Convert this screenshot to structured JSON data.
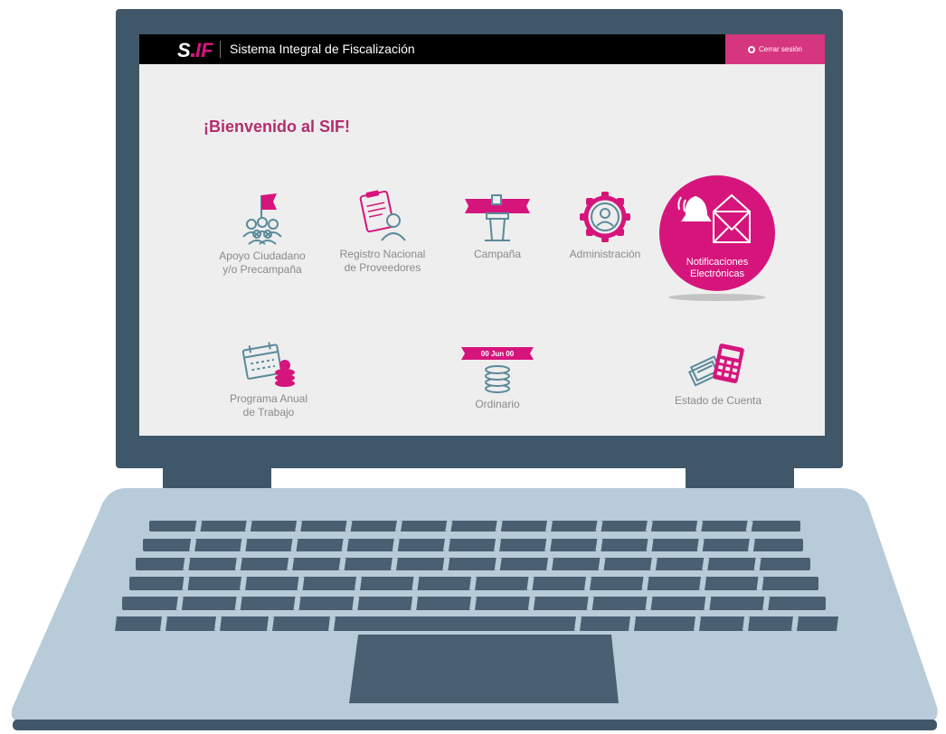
{
  "colors": {
    "brand_pink": "#d6157c",
    "title_pink": "#b32d6f",
    "topbar": "#000000",
    "screen_bg": "#eeeeee",
    "bezel": "#3f5768",
    "laptop_body": "#b8cbd8",
    "keys": "#4a6072"
  },
  "header": {
    "logo_text": "SIF",
    "app_title": "Sistema Integral de Fiscalización",
    "logout_label": "Cerrar sesión",
    "logout_icon": "power-icon"
  },
  "welcome_title": "¡Bienvenido al SIF!",
  "modules": [
    {
      "id": "apoyo",
      "line1": "Apoyo Ciudadano",
      "line2": "y/o Precampaña",
      "icon": "flag-people-icon"
    },
    {
      "id": "registro",
      "line1": "Registro Nacional",
      "line2": "de Proveedores",
      "icon": "clipboard-person-icon"
    },
    {
      "id": "campana",
      "line1": "Campaña",
      "icon": "podium-banner-icon"
    },
    {
      "id": "administracion",
      "line1": "Administración",
      "icon": "gear-person-icon"
    },
    {
      "id": "notificaciones",
      "line1": "Notificaciones",
      "line2": "Electrónicas",
      "icon": "bell-envelope-icon",
      "active": true
    },
    {
      "id": "programa",
      "line1": "Programa Anual",
      "line2": "de Trabajo",
      "icon": "calendar-coins-icon"
    },
    {
      "id": "ordinario",
      "line1": "Ordinario",
      "icon": "coins-date-icon",
      "banner_text": "00 Jun 00"
    },
    {
      "id": "estado",
      "line1": "Estado de Cuenta",
      "icon": "calculator-bills-icon"
    }
  ]
}
